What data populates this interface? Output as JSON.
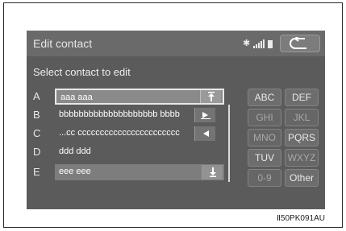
{
  "header": {
    "title": "Edit contact",
    "bluetooth_icon": "bluetooth-icon",
    "signal_icon": "signal-strength-icon",
    "battery_icon": "battery-icon",
    "back_icon": "back-arrow-icon"
  },
  "subtitle": "Select contact to edit",
  "contacts": [
    {
      "letter": "A",
      "name": "aaa aaa",
      "button_icon": "scroll-to-top-icon",
      "selected": true
    },
    {
      "letter": "B",
      "name": "bbbbbbbbbbbbbbbbbbbb bbbb",
      "button_icon": "scroll-right-icon"
    },
    {
      "letter": "C",
      "name": "...cc ccccccccccccccccccccccc",
      "button_icon": "scroll-left-icon"
    },
    {
      "letter": "D",
      "name": "ddd ddd"
    },
    {
      "letter": "E",
      "name": "eee eee",
      "button_icon": "scroll-to-bottom-icon"
    }
  ],
  "keypad": [
    {
      "label": "ABC",
      "dim": false
    },
    {
      "label": "DEF",
      "dim": false
    },
    {
      "label": "GHI",
      "dim": true
    },
    {
      "label": "JKL",
      "dim": true
    },
    {
      "label": "MNO",
      "dim": true
    },
    {
      "label": "PQRS",
      "dim": false
    },
    {
      "label": "TUV",
      "dim": false
    },
    {
      "label": "WXYZ",
      "dim": true
    },
    {
      "label": "0-9",
      "dim": true
    },
    {
      "label": "Other",
      "dim": false
    }
  ],
  "figure_code": "Ⅱ50PK091AU"
}
